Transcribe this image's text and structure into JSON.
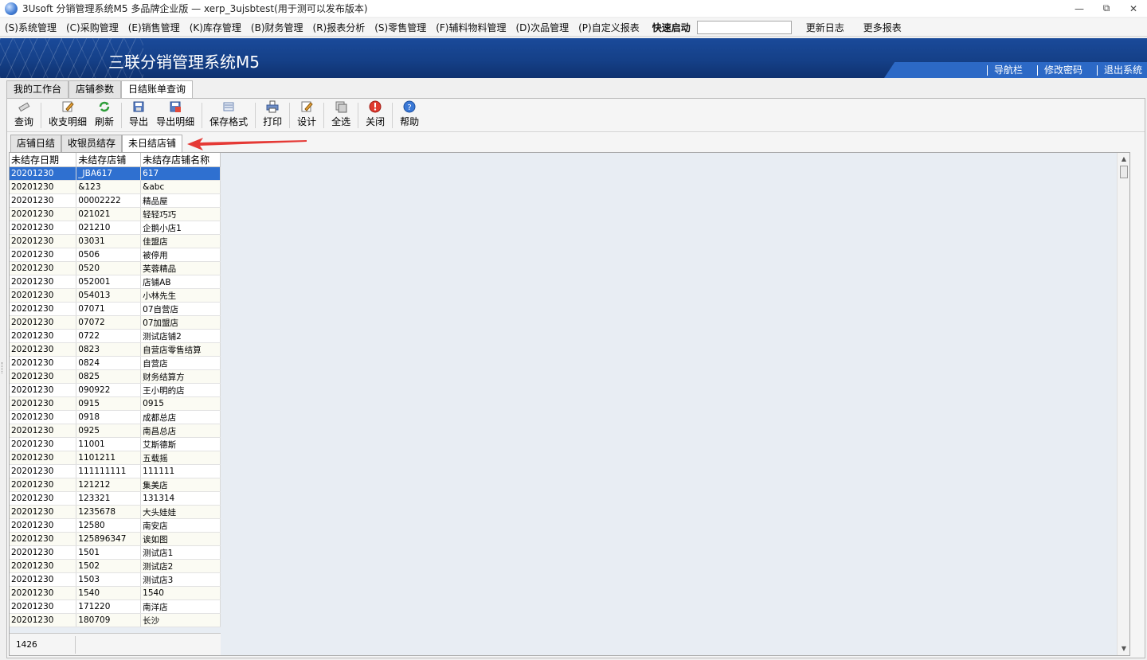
{
  "window": {
    "title": "3Usoft 分销管理系统M5 多品牌企业版 — xerp_3ujsbtest(用于测可以发布版本)",
    "minimize": "▭",
    "restore": "⧉",
    "close": "✕"
  },
  "menu": {
    "items": [
      "(S)系统管理",
      "(C)采购管理",
      "(E)销售管理",
      "(K)库存管理",
      "(B)财务管理",
      "(R)报表分析",
      "(S)零售管理",
      "(F)辅料物料管理",
      "(D)次品管理",
      "(P)自定义报表"
    ],
    "quick_start_label": "快速启动",
    "quick_start_value": "",
    "update_log": "更新日志",
    "more_reports": "更多报表"
  },
  "banner": {
    "brand": "三联分销管理系统M5",
    "nav": [
      "导航栏",
      "修改密码",
      "退出系统"
    ],
    "color": "#154088"
  },
  "main_tabs": [
    "我的工作台",
    "店铺参数",
    "日结账单查询"
  ],
  "toolbar": [
    {
      "label": "查询",
      "icon": "eraser-icon"
    },
    {
      "label": "收支明细",
      "icon": "edit-icon"
    },
    {
      "label": "刷新",
      "icon": "refresh-icon"
    },
    {
      "label": "导出",
      "icon": "save-icon"
    },
    {
      "label": "导出明细",
      "icon": "export-icon"
    },
    {
      "label": "保存格式",
      "icon": "format-icon"
    },
    {
      "label": "打印",
      "icon": "print-icon"
    },
    {
      "label": "设计",
      "icon": "design-icon"
    },
    {
      "label": "全选",
      "icon": "select-all-icon"
    },
    {
      "label": "关闭",
      "icon": "close-icon"
    },
    {
      "label": "帮助",
      "icon": "help-icon"
    }
  ],
  "sub_tabs": [
    "店铺日结",
    "收银员结存",
    "未日结店铺"
  ],
  "table": {
    "columns": [
      "未结存日期",
      "未结存店铺",
      "未结存店铺名称"
    ],
    "rows": [
      [
        "20201230",
        "_JBA617",
        "617"
      ],
      [
        "20201230",
        "&123",
        "&abc"
      ],
      [
        "20201230",
        "00002222",
        "精品屋"
      ],
      [
        "20201230",
        "021021",
        "轻轻巧巧"
      ],
      [
        "20201230",
        "021210",
        "企鹅小店1"
      ],
      [
        "20201230",
        "03031",
        "佳盟店"
      ],
      [
        "20201230",
        "0506",
        "被停用"
      ],
      [
        "20201230",
        "0520",
        "芙蓉精品"
      ],
      [
        "20201230",
        "052001",
        "店铺AB"
      ],
      [
        "20201230",
        "054013",
        "小林先生"
      ],
      [
        "20201230",
        "07071",
        "07自营店"
      ],
      [
        "20201230",
        "07072",
        "07加盟店"
      ],
      [
        "20201230",
        "0722",
        "测试店铺2"
      ],
      [
        "20201230",
        "0823",
        "自营店零售结算"
      ],
      [
        "20201230",
        "0824",
        "自营店"
      ],
      [
        "20201230",
        "0825",
        "财务结算方"
      ],
      [
        "20201230",
        "090922",
        "王小明的店"
      ],
      [
        "20201230",
        "0915",
        "0915"
      ],
      [
        "20201230",
        "0918",
        "成都总店"
      ],
      [
        "20201230",
        "0925",
        "南昌总店"
      ],
      [
        "20201230",
        "11001",
        "艾斯德斯"
      ],
      [
        "20201230",
        "1101211",
        "五载摇"
      ],
      [
        "20201230",
        "111111111",
        "111111"
      ],
      [
        "20201230",
        "121212",
        "集美店"
      ],
      [
        "20201230",
        "123321",
        "131314"
      ],
      [
        "20201230",
        "1235678",
        "大头娃娃"
      ],
      [
        "20201230",
        "12580",
        "南安店"
      ],
      [
        "20201230",
        "125896347",
        "诶如图"
      ],
      [
        "20201230",
        "1501",
        "测试店1"
      ],
      [
        "20201230",
        "1502",
        "测试店2"
      ],
      [
        "20201230",
        "1503",
        "测试店3"
      ],
      [
        "20201230",
        "1540",
        "1540"
      ],
      [
        "20201230",
        "171220",
        "南洋店"
      ],
      [
        "20201230",
        "180709",
        "长沙"
      ]
    ],
    "selected_row": 0,
    "footer_count": "1426"
  },
  "scroll": {
    "up": "▲",
    "down": "▼"
  },
  "accent_color": "#2f70d0",
  "annotation_color": "#e53935"
}
